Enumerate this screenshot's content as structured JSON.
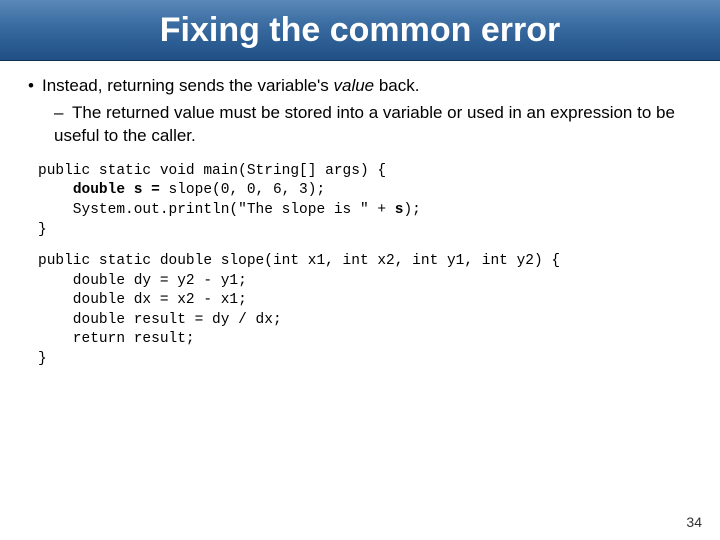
{
  "title": "Fixing the common error",
  "bullet_pre": "Instead, returning sends the variable's ",
  "bullet_italic": "value",
  "bullet_post": " back.",
  "subbullet": "The returned value must be stored into a variable or used in an expression to be useful to the caller.",
  "code1": {
    "l1a": "public static void main(String[] args) {",
    "l2a": "    ",
    "l2b": "double s = ",
    "l2c": "slope(0, 0, 6, 3);",
    "l3a": "    System.out.println(\"The slope is \" + ",
    "l3b": "s",
    "l3c": ");",
    "l4": "}"
  },
  "code2": {
    "l1": "public static double slope(int x1, int x2, int y1, int y2) {",
    "l2": "    double dy = y2 - y1;",
    "l3": "    double dx = x2 - x1;",
    "l4": "    double result = dy / dx;",
    "l5": "    return result;",
    "l6": "}"
  },
  "page_number": "34"
}
